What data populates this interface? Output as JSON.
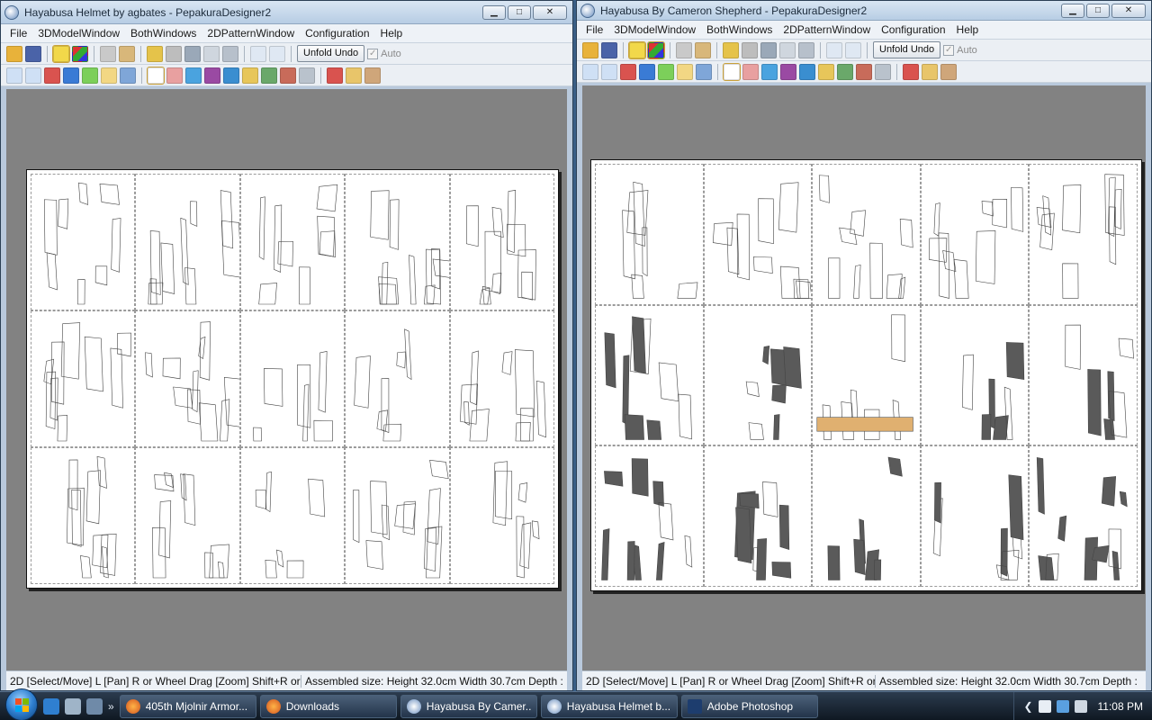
{
  "windows": [
    {
      "title": "Hayabusa Helmet by agbates - PepakuraDesigner2",
      "menu": [
        "File",
        "3DModelWindow",
        "BothWindows",
        "2DPatternWindow",
        "Configuration",
        "Help"
      ],
      "unfold_undo_label": "Unfold Undo",
      "auto_label": "Auto",
      "status_left": "2D [Select/Move] L [Pan] R or Wheel Drag [Zoom] Shift+R or '",
      "status_right": "Assembled size: Height 32.0cm Width 30.7cm Depth :"
    },
    {
      "title": "Hayabusa By Cameron Shepherd - PepakuraDesigner2",
      "menu": [
        "File",
        "3DModelWindow",
        "BothWindows",
        "2DPatternWindow",
        "Configuration",
        "Help"
      ],
      "unfold_undo_label": "Unfold Undo",
      "auto_label": "Auto",
      "status_left": "2D [Select/Move] L [Pan] R or Wheel Drag [Zoom] Shift+R or '",
      "status_right": "Assembled size: Height 32.0cm Width 30.7cm Depth :"
    }
  ],
  "caption_buttons": {
    "minimize": "▁",
    "maximize": "□",
    "close": "✕"
  },
  "auto_check": "✓",
  "taskbar": {
    "quicklaunch_more": "»",
    "items": [
      {
        "label": "405th Mjolnir Armor...",
        "icon": "firefox-icon"
      },
      {
        "label": "Downloads",
        "icon": "firefox-icon"
      },
      {
        "label": "Hayabusa By Camer...",
        "icon": "pepakura-icon"
      },
      {
        "label": "Hayabusa Helmet b...",
        "icon": "pepakura-icon"
      },
      {
        "label": "Adobe Photoshop",
        "icon": "photoshop-icon"
      }
    ],
    "tray_chevron": "❮",
    "clock": "11:08 PM"
  },
  "colors": {
    "desktop": "#3a5f86",
    "workspace": "#828282",
    "sheet": "#ffffff",
    "filled_part": "#5a5a5a",
    "highlight_part": "#e0b070"
  }
}
